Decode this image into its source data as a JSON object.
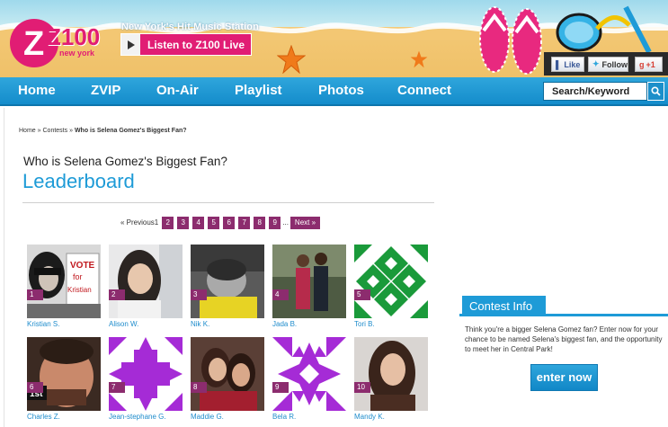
{
  "header": {
    "logo_text": "Z100",
    "logo_sub": "new york",
    "tagline": "New York's Hit Music Station",
    "listen_label": "Listen to Z100 Live",
    "social": {
      "like": "Like",
      "follow": "Follow",
      "gplus": "+1"
    },
    "colors": {
      "brand_pink": "#e11d74",
      "sky": "#9fd9ec",
      "sand": "#f3c773"
    }
  },
  "nav": {
    "items": [
      "Home",
      "ZVIP",
      "On-Air",
      "Playlist",
      "Photos",
      "Connect"
    ],
    "search_placeholder": "Search/Keyword"
  },
  "breadcrumb": {
    "home": "Home",
    "sep": "»",
    "contests": "Contests",
    "current": "Who is Selena Gomez's Biggest Fan?"
  },
  "page": {
    "title": "Who is Selena Gomez's Biggest Fan?",
    "subtitle": "Leaderboard",
    "accent": "#1e9bd7"
  },
  "pagination": {
    "previous": "« Previous",
    "current": "1",
    "pages": [
      "2",
      "3",
      "4",
      "5",
      "6",
      "7",
      "8",
      "9"
    ],
    "ellipsis": "...",
    "next": "Next »"
  },
  "entries": [
    {
      "rank": "1",
      "name": "Kristian S.",
      "photo": "photo-vote-sign"
    },
    {
      "rank": "2",
      "name": "Alison W.",
      "photo": "photo-girl-selfie"
    },
    {
      "rank": "3",
      "name": "Nik K.",
      "photo": "photo-boy-sleeping"
    },
    {
      "rank": "4",
      "name": "Jada B.",
      "photo": "photo-couple"
    },
    {
      "rank": "5",
      "name": "Tori B.",
      "photo": "identicon-green"
    },
    {
      "rank": "6",
      "name": "Charles Z.",
      "photo": "photo-man-1st"
    },
    {
      "rank": "7",
      "name": "Jean-stephane G.",
      "photo": "identicon-purple"
    },
    {
      "rank": "8",
      "name": "Maddie G.",
      "photo": "photo-two-girls"
    },
    {
      "rank": "9",
      "name": "Bela R.",
      "photo": "identicon-purple-2"
    },
    {
      "rank": "10",
      "name": "Mandy K.",
      "photo": "photo-selena"
    }
  ],
  "contest_info": {
    "heading": "Contest Info",
    "body": "Think you're a bigger Selena Gomez fan? Enter now for your chance to be named Selena's biggest fan, and the opportunity to meet her in Central Park!",
    "button": "enter now"
  }
}
